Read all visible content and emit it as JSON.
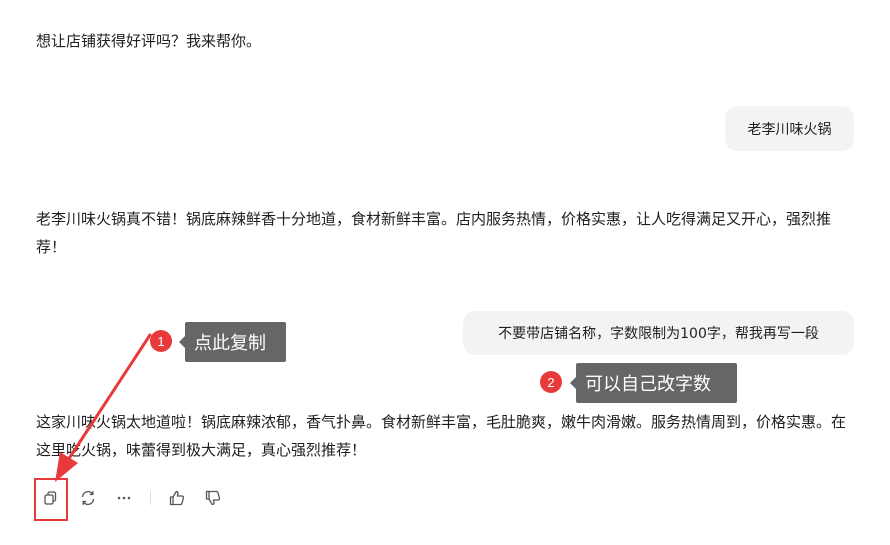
{
  "chat": {
    "greeting": "想让店铺获得好评吗？我来帮你。",
    "user_message_1": "老李川味火锅",
    "ai_reply_1": "老李川味火锅真不错！锅底麻辣鲜香十分地道，食材新鲜丰富。店内服务热情，价格实惠，让人吃得满足又开心，强烈推荐！",
    "user_message_2": "不要带店铺名称，字数限制为100字，帮我再写一段",
    "ai_reply_2": "这家川味火锅太地道啦！锅底麻辣浓郁，香气扑鼻。食材新鲜丰富，毛肚脆爽，嫩牛肉滑嫩。服务热情周到，价格实惠。在这里吃火锅，味蕾得到极大满足，真心强烈推荐！"
  },
  "annotations": {
    "badge_1": "1",
    "callout_1": "点此复制",
    "badge_2": "2",
    "callout_2": "可以自己改字数",
    "accent_color": "#e8393b",
    "callout_color": "#666666"
  },
  "actions": {
    "icons": [
      "copy-icon",
      "regenerate-icon",
      "more-icon",
      "thumbs-up-icon",
      "thumbs-down-icon"
    ]
  }
}
